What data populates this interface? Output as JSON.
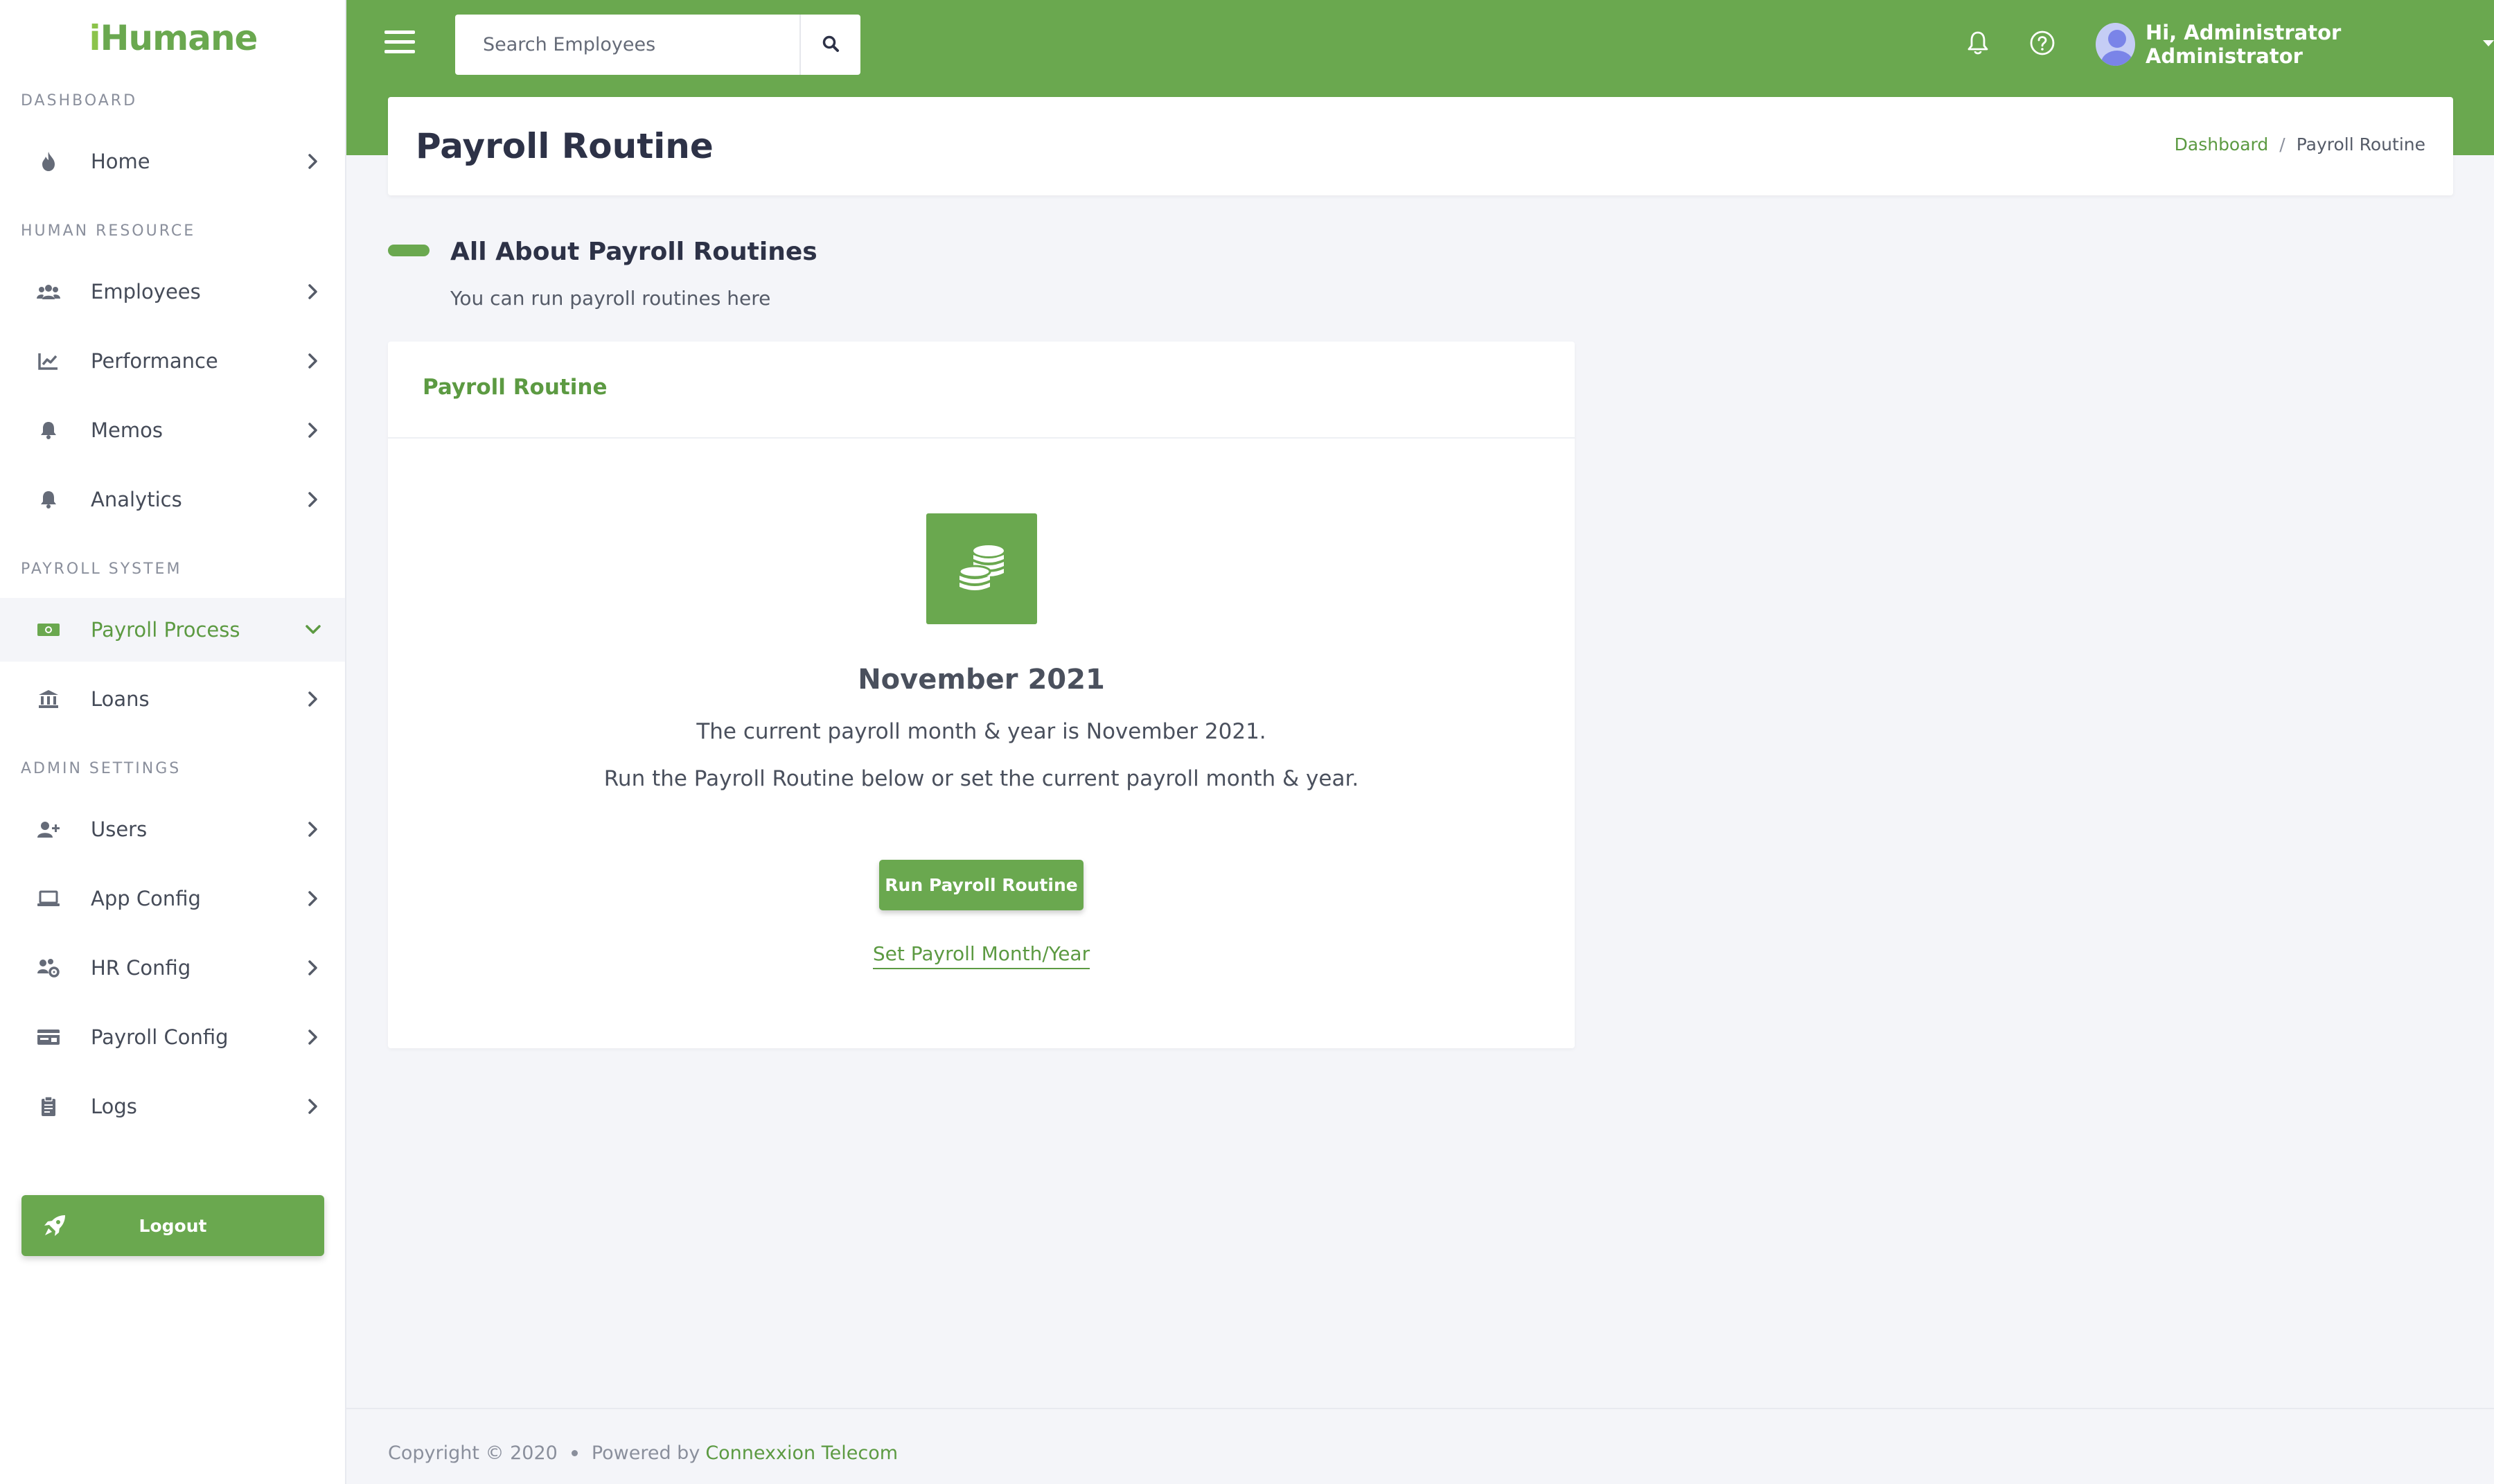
{
  "app": {
    "logo_prefix": "i",
    "logo_text": "Humane",
    "brand_color": "#6aa84f"
  },
  "sidebar": {
    "sections": [
      {
        "label": "DASHBOARD"
      },
      {
        "label": "HUMAN RESOURCE"
      },
      {
        "label": "PAYROLL SYSTEM"
      },
      {
        "label": "ADMIN SETTINGS"
      }
    ],
    "items": [
      {
        "label": "Home",
        "icon": "fire-icon"
      },
      {
        "label": "Employees",
        "icon": "users-icon"
      },
      {
        "label": "Performance",
        "icon": "chart-line-icon"
      },
      {
        "label": "Memos",
        "icon": "bell-icon"
      },
      {
        "label": "Analytics",
        "icon": "bell-icon"
      },
      {
        "label": "Payroll Process",
        "icon": "money-bill-icon",
        "active": true
      },
      {
        "label": "Loans",
        "icon": "bank-icon"
      },
      {
        "label": "Users",
        "icon": "user-plus-icon"
      },
      {
        "label": "App Config",
        "icon": "laptop-icon"
      },
      {
        "label": "HR Config",
        "icon": "users-cog-icon"
      },
      {
        "label": "Payroll Config",
        "icon": "money-check-icon"
      },
      {
        "label": "Logs",
        "icon": "clipboard-icon"
      }
    ],
    "logout_label": "Logout"
  },
  "topbar": {
    "search_placeholder": "Search Employees",
    "user_greeting": "Hi, Administrator Administrator"
  },
  "page": {
    "title": "Payroll Routine",
    "breadcrumb": {
      "link": "Dashboard",
      "separator": "/",
      "current": "Payroll Routine"
    },
    "section_heading": "All About Payroll Routines",
    "section_sub": "You can run payroll routines here"
  },
  "card": {
    "title": "Payroll Routine",
    "icon": "coins-icon",
    "month_year": "November 2021",
    "line1": "The current payroll month & year is November 2021.",
    "line2": "Run the Payroll Routine below or set the current payroll month & year.",
    "run_button": "Run Payroll Routine",
    "set_link": "Set Payroll Month/Year"
  },
  "footer": {
    "copyright": "Copyright © 2020",
    "powered_by": "Powered by",
    "company": "Connexxion Telecom"
  }
}
